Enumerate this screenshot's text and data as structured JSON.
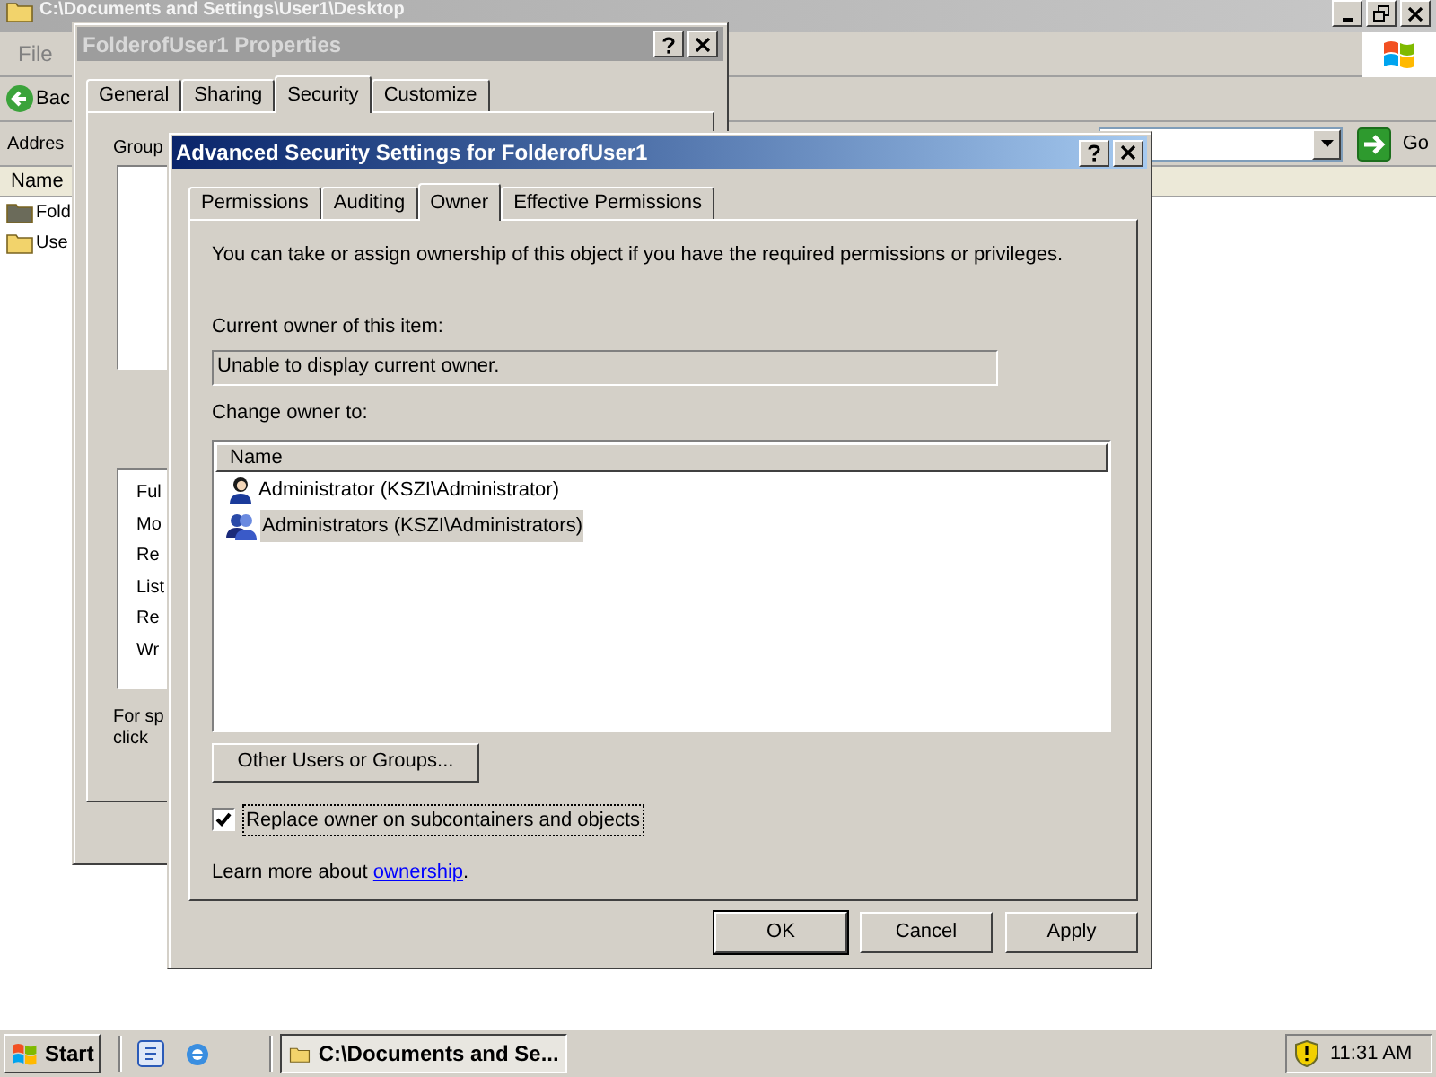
{
  "explorer_window": {
    "title": "C:\\Documents and Settings\\User1\\Desktop",
    "menu": [
      "File"
    ],
    "back_label": "Bac",
    "address_label": "Addres",
    "go_label": "Go",
    "list": {
      "column": "Name",
      "items": [
        {
          "label": "Fold",
          "kind": "dark-folder"
        },
        {
          "label": "Use",
          "kind": "folder"
        }
      ]
    }
  },
  "properties_window": {
    "title": "FolderofUser1 Properties",
    "tabs": [
      {
        "label": "General",
        "selected": false
      },
      {
        "label": "Sharing",
        "selected": false
      },
      {
        "label": "Security",
        "selected": true
      },
      {
        "label": "Customize",
        "selected": false
      }
    ],
    "group_label": "Group",
    "permissions": [
      "Ful",
      "Mo",
      "Re",
      "List",
      "Re",
      "Wr"
    ],
    "note_lines": [
      "For sp",
      "click"
    ]
  },
  "advanced_dialog": {
    "title": "Advanced Security Settings for FolderofUser1",
    "tabs": [
      {
        "label": "Permissions",
        "selected": false
      },
      {
        "label": "Auditing",
        "selected": false
      },
      {
        "label": "Owner",
        "selected": true
      },
      {
        "label": "Effective Permissions",
        "selected": false
      }
    ],
    "intro": "You can take or assign ownership of this object if you have the required permissions or privileges.",
    "current_owner_label": "Current owner of this item:",
    "current_owner_value": "Unable to display current owner.",
    "change_owner_label": "Change owner to:",
    "owners_column": "Name",
    "owners": [
      {
        "label": "Administrator (KSZI\\Administrator)",
        "kind": "user",
        "selected": false
      },
      {
        "label": "Administrators (KSZI\\Administrators)",
        "kind": "group",
        "selected": true
      }
    ],
    "other_button": "Other Users or Groups...",
    "replace_checkbox": {
      "label": "Replace owner on subcontainers and objects",
      "checked": true
    },
    "learn_more": "Learn more about **ownership**.",
    "buttons": [
      "OK",
      "Cancel",
      "Apply"
    ]
  },
  "taskbar": {
    "start_label": "Start",
    "task_label": "C:\\Documents and Se...",
    "clock": "11:31 AM"
  }
}
